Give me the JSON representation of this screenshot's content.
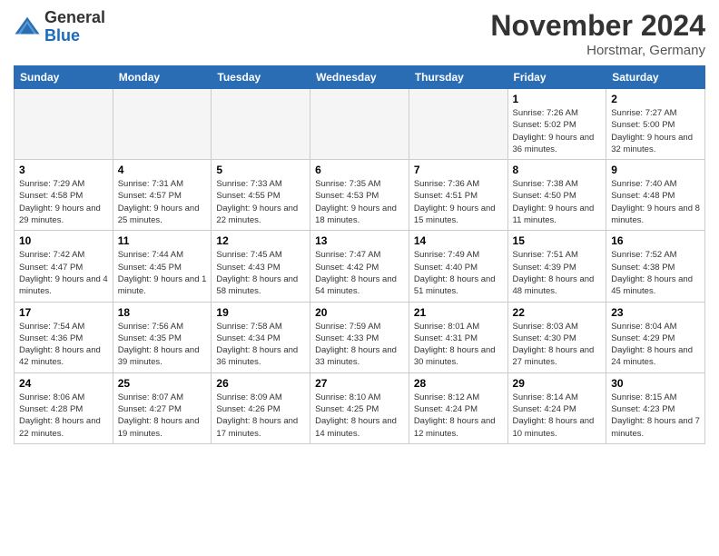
{
  "header": {
    "logo_general": "General",
    "logo_blue": "Blue",
    "title": "November 2024",
    "location": "Horstmar, Germany"
  },
  "weekdays": [
    "Sunday",
    "Monday",
    "Tuesday",
    "Wednesday",
    "Thursday",
    "Friday",
    "Saturday"
  ],
  "weeks": [
    [
      {
        "day": "",
        "info": "",
        "empty": true
      },
      {
        "day": "",
        "info": "",
        "empty": true
      },
      {
        "day": "",
        "info": "",
        "empty": true
      },
      {
        "day": "",
        "info": "",
        "empty": true
      },
      {
        "day": "",
        "info": "",
        "empty": true
      },
      {
        "day": "1",
        "info": "Sunrise: 7:26 AM\nSunset: 5:02 PM\nDaylight: 9 hours and 36 minutes.",
        "empty": false
      },
      {
        "day": "2",
        "info": "Sunrise: 7:27 AM\nSunset: 5:00 PM\nDaylight: 9 hours and 32 minutes.",
        "empty": false
      }
    ],
    [
      {
        "day": "3",
        "info": "Sunrise: 7:29 AM\nSunset: 4:58 PM\nDaylight: 9 hours and 29 minutes.",
        "empty": false
      },
      {
        "day": "4",
        "info": "Sunrise: 7:31 AM\nSunset: 4:57 PM\nDaylight: 9 hours and 25 minutes.",
        "empty": false
      },
      {
        "day": "5",
        "info": "Sunrise: 7:33 AM\nSunset: 4:55 PM\nDaylight: 9 hours and 22 minutes.",
        "empty": false
      },
      {
        "day": "6",
        "info": "Sunrise: 7:35 AM\nSunset: 4:53 PM\nDaylight: 9 hours and 18 minutes.",
        "empty": false
      },
      {
        "day": "7",
        "info": "Sunrise: 7:36 AM\nSunset: 4:51 PM\nDaylight: 9 hours and 15 minutes.",
        "empty": false
      },
      {
        "day": "8",
        "info": "Sunrise: 7:38 AM\nSunset: 4:50 PM\nDaylight: 9 hours and 11 minutes.",
        "empty": false
      },
      {
        "day": "9",
        "info": "Sunrise: 7:40 AM\nSunset: 4:48 PM\nDaylight: 9 hours and 8 minutes.",
        "empty": false
      }
    ],
    [
      {
        "day": "10",
        "info": "Sunrise: 7:42 AM\nSunset: 4:47 PM\nDaylight: 9 hours and 4 minutes.",
        "empty": false
      },
      {
        "day": "11",
        "info": "Sunrise: 7:44 AM\nSunset: 4:45 PM\nDaylight: 9 hours and 1 minute.",
        "empty": false
      },
      {
        "day": "12",
        "info": "Sunrise: 7:45 AM\nSunset: 4:43 PM\nDaylight: 8 hours and 58 minutes.",
        "empty": false
      },
      {
        "day": "13",
        "info": "Sunrise: 7:47 AM\nSunset: 4:42 PM\nDaylight: 8 hours and 54 minutes.",
        "empty": false
      },
      {
        "day": "14",
        "info": "Sunrise: 7:49 AM\nSunset: 4:40 PM\nDaylight: 8 hours and 51 minutes.",
        "empty": false
      },
      {
        "day": "15",
        "info": "Sunrise: 7:51 AM\nSunset: 4:39 PM\nDaylight: 8 hours and 48 minutes.",
        "empty": false
      },
      {
        "day": "16",
        "info": "Sunrise: 7:52 AM\nSunset: 4:38 PM\nDaylight: 8 hours and 45 minutes.",
        "empty": false
      }
    ],
    [
      {
        "day": "17",
        "info": "Sunrise: 7:54 AM\nSunset: 4:36 PM\nDaylight: 8 hours and 42 minutes.",
        "empty": false
      },
      {
        "day": "18",
        "info": "Sunrise: 7:56 AM\nSunset: 4:35 PM\nDaylight: 8 hours and 39 minutes.",
        "empty": false
      },
      {
        "day": "19",
        "info": "Sunrise: 7:58 AM\nSunset: 4:34 PM\nDaylight: 8 hours and 36 minutes.",
        "empty": false
      },
      {
        "day": "20",
        "info": "Sunrise: 7:59 AM\nSunset: 4:33 PM\nDaylight: 8 hours and 33 minutes.",
        "empty": false
      },
      {
        "day": "21",
        "info": "Sunrise: 8:01 AM\nSunset: 4:31 PM\nDaylight: 8 hours and 30 minutes.",
        "empty": false
      },
      {
        "day": "22",
        "info": "Sunrise: 8:03 AM\nSunset: 4:30 PM\nDaylight: 8 hours and 27 minutes.",
        "empty": false
      },
      {
        "day": "23",
        "info": "Sunrise: 8:04 AM\nSunset: 4:29 PM\nDaylight: 8 hours and 24 minutes.",
        "empty": false
      }
    ],
    [
      {
        "day": "24",
        "info": "Sunrise: 8:06 AM\nSunset: 4:28 PM\nDaylight: 8 hours and 22 minutes.",
        "empty": false
      },
      {
        "day": "25",
        "info": "Sunrise: 8:07 AM\nSunset: 4:27 PM\nDaylight: 8 hours and 19 minutes.",
        "empty": false
      },
      {
        "day": "26",
        "info": "Sunrise: 8:09 AM\nSunset: 4:26 PM\nDaylight: 8 hours and 17 minutes.",
        "empty": false
      },
      {
        "day": "27",
        "info": "Sunrise: 8:10 AM\nSunset: 4:25 PM\nDaylight: 8 hours and 14 minutes.",
        "empty": false
      },
      {
        "day": "28",
        "info": "Sunrise: 8:12 AM\nSunset: 4:24 PM\nDaylight: 8 hours and 12 minutes.",
        "empty": false
      },
      {
        "day": "29",
        "info": "Sunrise: 8:14 AM\nSunset: 4:24 PM\nDaylight: 8 hours and 10 minutes.",
        "empty": false
      },
      {
        "day": "30",
        "info": "Sunrise: 8:15 AM\nSunset: 4:23 PM\nDaylight: 8 hours and 7 minutes.",
        "empty": false
      }
    ]
  ]
}
